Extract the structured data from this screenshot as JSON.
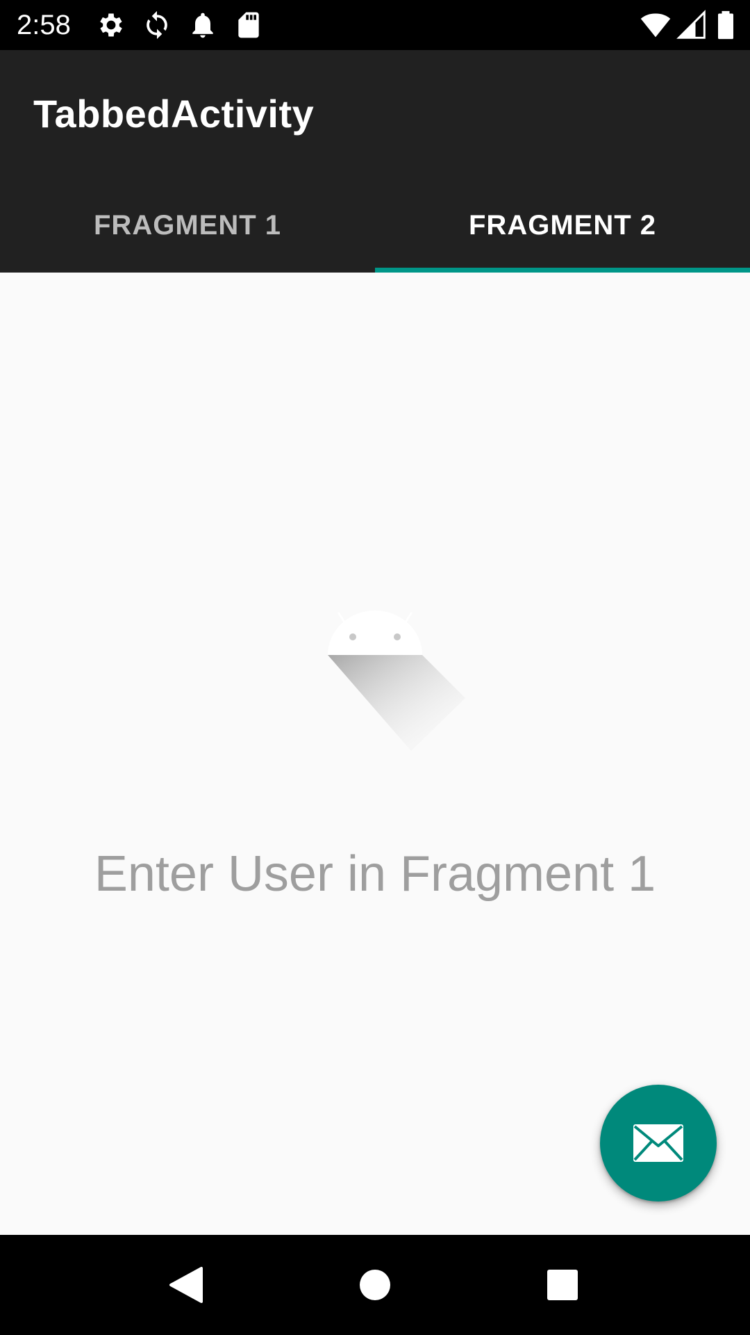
{
  "status_bar": {
    "time": "2:58",
    "icons": [
      "gear-icon",
      "sync-icon",
      "notification-bell-icon",
      "sd-card-icon",
      "wifi-icon",
      "cell-signal-icon",
      "battery-icon"
    ]
  },
  "app_bar": {
    "title": "TabbedActivity",
    "tabs": [
      {
        "label": "FRAGMENT 1",
        "selected": false
      },
      {
        "label": "FRAGMENT 2",
        "selected": true
      }
    ]
  },
  "content": {
    "illustration": "android-empty-state-icon",
    "message": "Enter User in Fragment 1"
  },
  "fab": {
    "icon": "envelope-icon"
  },
  "nav_bar": {
    "buttons": [
      "back-icon",
      "home-icon",
      "recents-icon"
    ]
  },
  "colors": {
    "app_bar": "#212121",
    "accent": "#009688",
    "fab": "#00897b",
    "background": "#fafafa",
    "message_text": "#9e9e9e"
  }
}
